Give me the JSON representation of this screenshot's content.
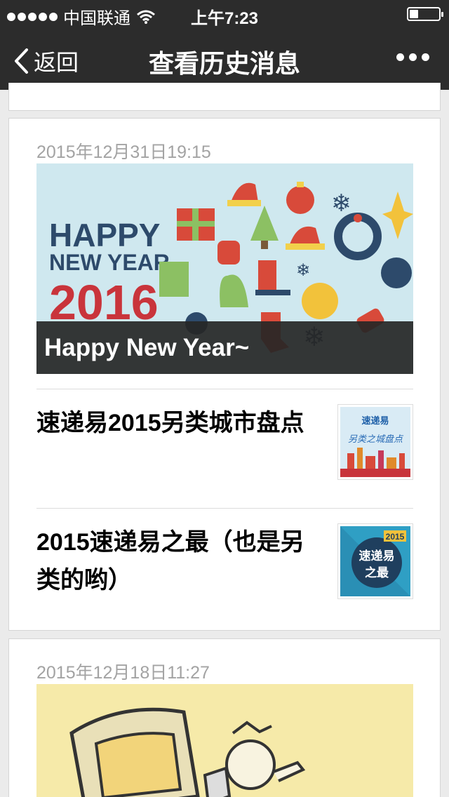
{
  "status_bar": {
    "carrier": "中国联通",
    "time": "上午7:23",
    "battery_level": 0.3
  },
  "nav": {
    "back_label": "返回",
    "title": "查看历史消息"
  },
  "messages": [
    {
      "date": "2015年12月31日19:15",
      "cover": {
        "caption": "Happy New Year~",
        "art_line1": "HAPPY",
        "art_line2": "NEW YEAR",
        "art_year": "2016"
      },
      "articles": [
        {
          "title": "速递易2015另类城市盘点",
          "thumb_brand": "速递易",
          "thumb_sub": "另类之城盘点"
        },
        {
          "title": "2015速递易之最（也是另类的哟）",
          "thumb_year": "2015",
          "thumb_line1": "速递易",
          "thumb_line2": "之最"
        }
      ]
    },
    {
      "date": "2015年12月18日11:27"
    }
  ]
}
